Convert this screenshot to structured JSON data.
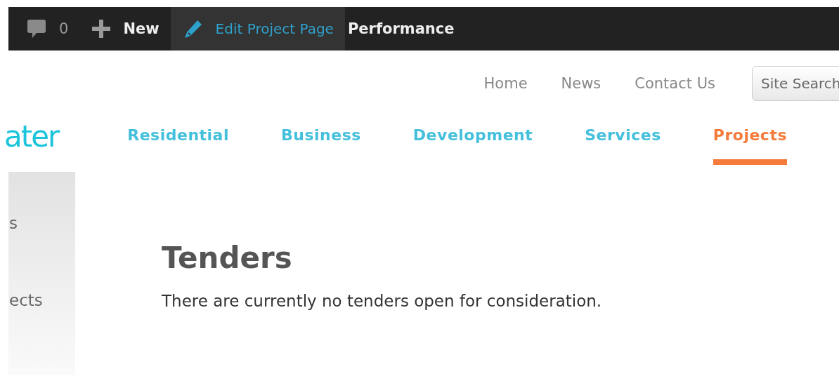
{
  "admin_bar": {
    "items": [
      {
        "kind": "comments",
        "label": "0"
      },
      {
        "kind": "new",
        "label": "New"
      },
      {
        "kind": "edit",
        "label": "Edit Project Page",
        "selected": true
      },
      {
        "kind": "plain",
        "label": "Performance",
        "selected": false
      }
    ]
  },
  "top_nav": {
    "links": [
      "Home",
      "News",
      "Contact Us"
    ],
    "search": {
      "placeholder": "Site Search"
    }
  },
  "logo": "ater",
  "main_nav": [
    {
      "label": "Residential",
      "selected": false
    },
    {
      "label": "Business",
      "selected": false
    },
    {
      "label": "Development",
      "selected": false
    },
    {
      "label": "Services",
      "selected": false
    },
    {
      "label": "Projects",
      "selected": true
    }
  ],
  "sidebar": {
    "items": [
      "s",
      "ects"
    ]
  },
  "content": {
    "heading": "Tenders",
    "text": "There are currently no tenders open for consideration."
  }
}
